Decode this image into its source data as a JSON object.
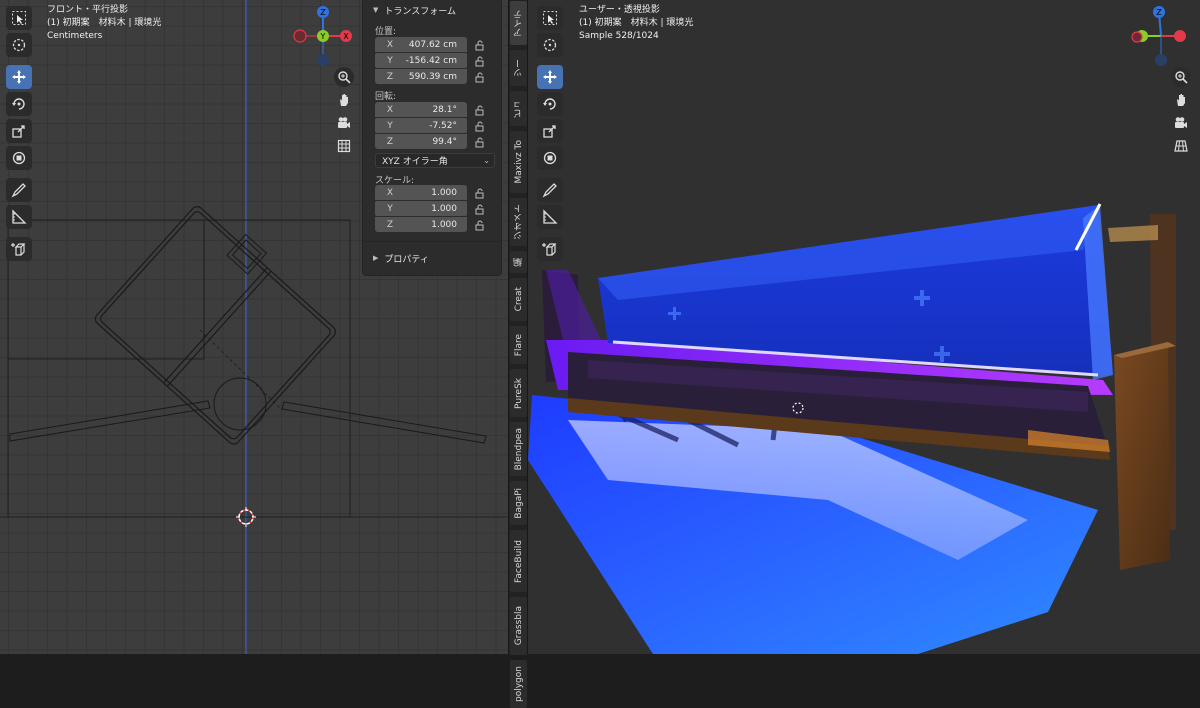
{
  "left_viewport": {
    "view_name": "フロント・平行投影",
    "collection": "(1) 初期案　材料木 | 環境光",
    "units": "Centimeters"
  },
  "right_viewport": {
    "view_name": "ユーザー・透視投影",
    "collection": "(1) 初期案　材料木 | 環境光",
    "sample": "Sample 528/1024"
  },
  "gizmo": {
    "z": "Z",
    "y": "Y",
    "x": "X"
  },
  "transform_panel": {
    "title": "トランスフォーム",
    "location_label": "位置:",
    "location": [
      {
        "axis": "X",
        "value": "407.62 cm"
      },
      {
        "axis": "Y",
        "value": "-156.42 cm"
      },
      {
        "axis": "Z",
        "value": "590.39 cm"
      }
    ],
    "rotation_label": "回転:",
    "rotation": [
      {
        "axis": "X",
        "value": "28.1°"
      },
      {
        "axis": "Y",
        "value": "-7.52°"
      },
      {
        "axis": "Z",
        "value": "99.4°"
      }
    ],
    "rotation_mode": "XYZ オイラー角",
    "scale_label": "スケール:",
    "scale": [
      {
        "axis": "X",
        "value": "1.000"
      },
      {
        "axis": "Y",
        "value": "1.000"
      },
      {
        "axis": "Z",
        "value": "1.000"
      }
    ],
    "properties_title": "プロパティ"
  },
  "sidebar_tabs": [
    "アイテ",
    "ツー",
    "ビュ",
    "Maxivz To",
    "ジオメト",
    "編",
    "Creat",
    "Flare",
    "PureSk",
    "Blendpea",
    "BagaPi",
    "FaceBuild",
    "Grassbla",
    "polygon"
  ],
  "tools_left": [
    "select-box",
    "cursor",
    "move",
    "rotate",
    "scale",
    "transform",
    "annotate",
    "measure",
    "add-cube"
  ],
  "tools_right": [
    "select-box",
    "cursor",
    "move",
    "rotate",
    "scale",
    "transform",
    "annotate",
    "measure",
    "add-cube"
  ],
  "colors": {
    "active_tool": "#4772b3",
    "axis_x": "#e3394a",
    "axis_y": "#8bcc29",
    "axis_z": "#2f73e0",
    "glass_blue": "#1a4cff",
    "neon_purple": "#8a2be2",
    "floor_blue": "#1f6fff"
  }
}
